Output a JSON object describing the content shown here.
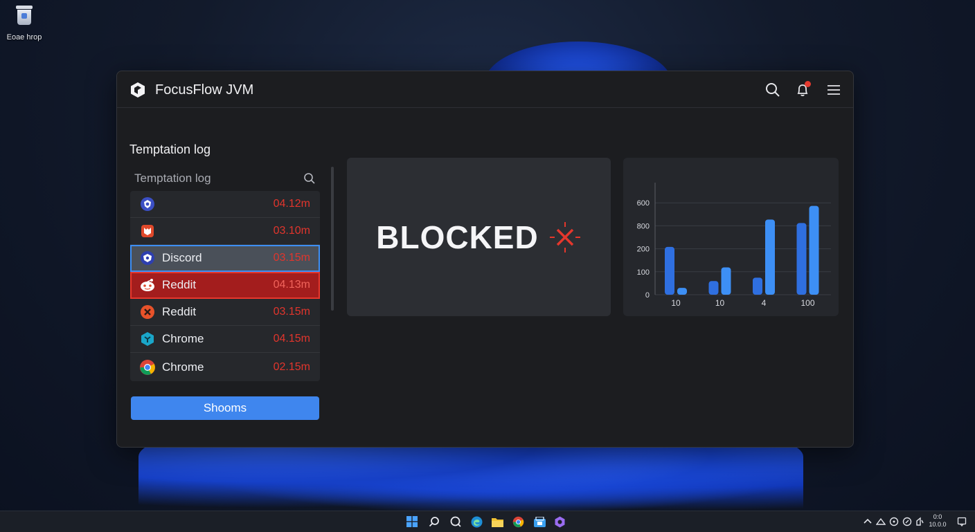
{
  "desktop": {
    "icon_label": "Eoae hrop"
  },
  "window": {
    "title": "FocusFlow JVM",
    "section_heading": "Temptation log",
    "search_placeholder": "Temptation log",
    "rows": [
      {
        "name": "",
        "time": "04.12m",
        "icon": "shield-app-icon",
        "state": "normal"
      },
      {
        "name": "",
        "time": "03.10m",
        "icon": "red-app-icon",
        "state": "normal"
      },
      {
        "name": "Discord",
        "time": "03.15m",
        "icon": "discord-icon",
        "state": "selected"
      },
      {
        "name": "Reddit",
        "time": "04.13m",
        "icon": "reddit-icon",
        "state": "danger"
      },
      {
        "name": "Reddit",
        "time": "03.15m",
        "icon": "close-circle-icon",
        "state": "normal"
      },
      {
        "name": "Chrome",
        "time": "04.15m",
        "icon": "hex-app-icon",
        "state": "normal"
      },
      {
        "name": "Chrome",
        "time": "02.15m",
        "icon": "chrome-icon",
        "state": "normal"
      }
    ],
    "primary_button": "Shooms",
    "blocked_label": "BLOCKED"
  },
  "chart_data": {
    "type": "bar",
    "y_tick_labels": [
      "0",
      "100",
      "200",
      "800",
      "600"
    ],
    "x_tick_labels": [
      "10",
      "10",
      "4",
      "100"
    ],
    "series": [
      {
        "values": [
          70,
          10,
          20,
          40,
          25,
          110,
          105,
          130
        ]
      }
    ],
    "ylim": [
      0,
      160
    ],
    "grid": true,
    "colors": [
      "#2f6fe0",
      "#3d8ff5"
    ]
  },
  "taskbar": {
    "clock_time": "0:0",
    "clock_date": "10.0.0"
  }
}
